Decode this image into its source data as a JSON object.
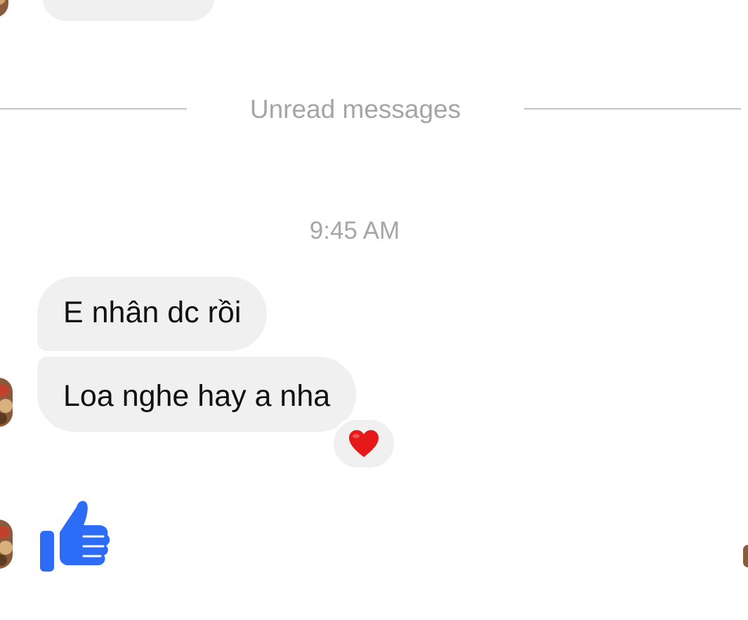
{
  "chat": {
    "unread_divider_label": "Unread messages",
    "timestamp": "9:45 AM",
    "messages": [
      {
        "text": "E nhân dc rồi"
      },
      {
        "text": "Loa nghe hay a nha",
        "reaction": "heart"
      }
    ],
    "last_message": {
      "type": "like",
      "icon": "thumbs-up-icon"
    }
  },
  "colors": {
    "bubble_incoming": "#f0f0f0",
    "divider": "#c4c4c4",
    "muted_text": "#a5a5a5",
    "like_blue": "#2c6cf6",
    "heart_red": "#e51919"
  }
}
